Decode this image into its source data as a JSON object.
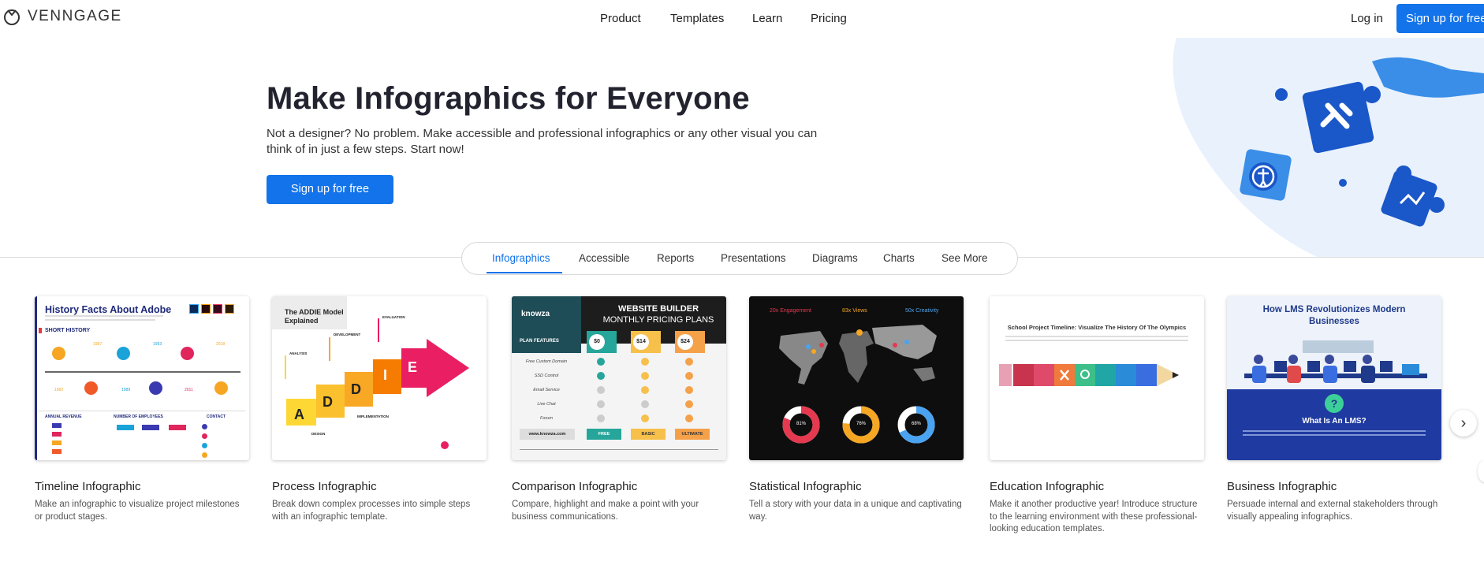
{
  "brand": {
    "name": "VENNGAGE"
  },
  "nav": {
    "links": [
      "Product",
      "Templates",
      "Learn",
      "Pricing"
    ],
    "login": "Log in",
    "signup": "Sign up for free"
  },
  "hero": {
    "title": "Make Infographics for Everyone",
    "subtitle": "Not a designer? No problem. Make accessible and professional infographics or any other visual you can think of in just a few steps. Start now!",
    "cta": "Sign up for free"
  },
  "tabs": {
    "items": [
      "Infographics",
      "Accessible",
      "Reports",
      "Presentations",
      "Diagrams",
      "Charts",
      "See More"
    ],
    "active": "Infographics"
  },
  "cards": [
    {
      "title": "Timeline Infographic",
      "desc": "Make an infographic to visualize project milestones or product stages."
    },
    {
      "title": "Process Infographic",
      "desc": "Break down complex processes into simple steps with an infographic template."
    },
    {
      "title": "Comparison Infographic",
      "desc": "Compare, highlight and make a point with your business communications."
    },
    {
      "title": "Statistical Infographic",
      "desc": "Tell a story with your data in a unique and captivating way."
    },
    {
      "title": "Education Infographic",
      "desc": "Make it another productive year! Introduce structure to the learning environment with these professional-looking education templates."
    },
    {
      "title": "Business Infographic",
      "desc": "Persuade internal and external stakeholders through visually appealing infographics."
    }
  ],
  "thumbs": {
    "timeline": {
      "title": "History Facts About Adobe",
      "section": "SHORT HISTORY",
      "revenue": "ANNUAL REVENUE",
      "employees": "NUMBER OF EMPLOYEES",
      "contact": "CONTACT",
      "years": [
        "1987",
        "1993",
        "2018",
        "1982",
        "1989",
        "2011"
      ]
    },
    "process": {
      "title": "The ADDIE Model Explained",
      "letters": [
        "A",
        "D",
        "D",
        "I",
        "E"
      ],
      "steps": [
        "ANALYSIS",
        "DESIGN",
        "DEVELOPMENT",
        "IMPLEMENTATION",
        "EVALUATION"
      ]
    },
    "comparison": {
      "brand": "knowza",
      "title": "WEBSITE BUILDER",
      "subtitle": "MONTHLY PRICING PLANS",
      "features_label": "PLAN FEATURES",
      "prices": [
        "$0",
        "$14",
        "$24"
      ],
      "features": [
        "Free Custom Domain",
        "SSD Control",
        "Email Service",
        "Live Chat",
        "Forum"
      ],
      "site": "www.knowza.com",
      "plans": [
        "FREE",
        "BASIC",
        "ULTIMATE"
      ]
    },
    "statistical": {
      "stats": [
        "20x Engagement",
        "83x Views",
        "50x Creativity"
      ],
      "donuts": [
        "81%",
        "76%",
        "68%"
      ]
    },
    "education": {
      "title": "School Project Timeline: Visualize The History Of The Olympics"
    },
    "business": {
      "title": "How LMS Revolutionizes Modern Businesses",
      "question": "What Is An LMS?"
    }
  },
  "colors": {
    "accent": "#1273eb",
    "hero_art": "#1a57c8"
  }
}
